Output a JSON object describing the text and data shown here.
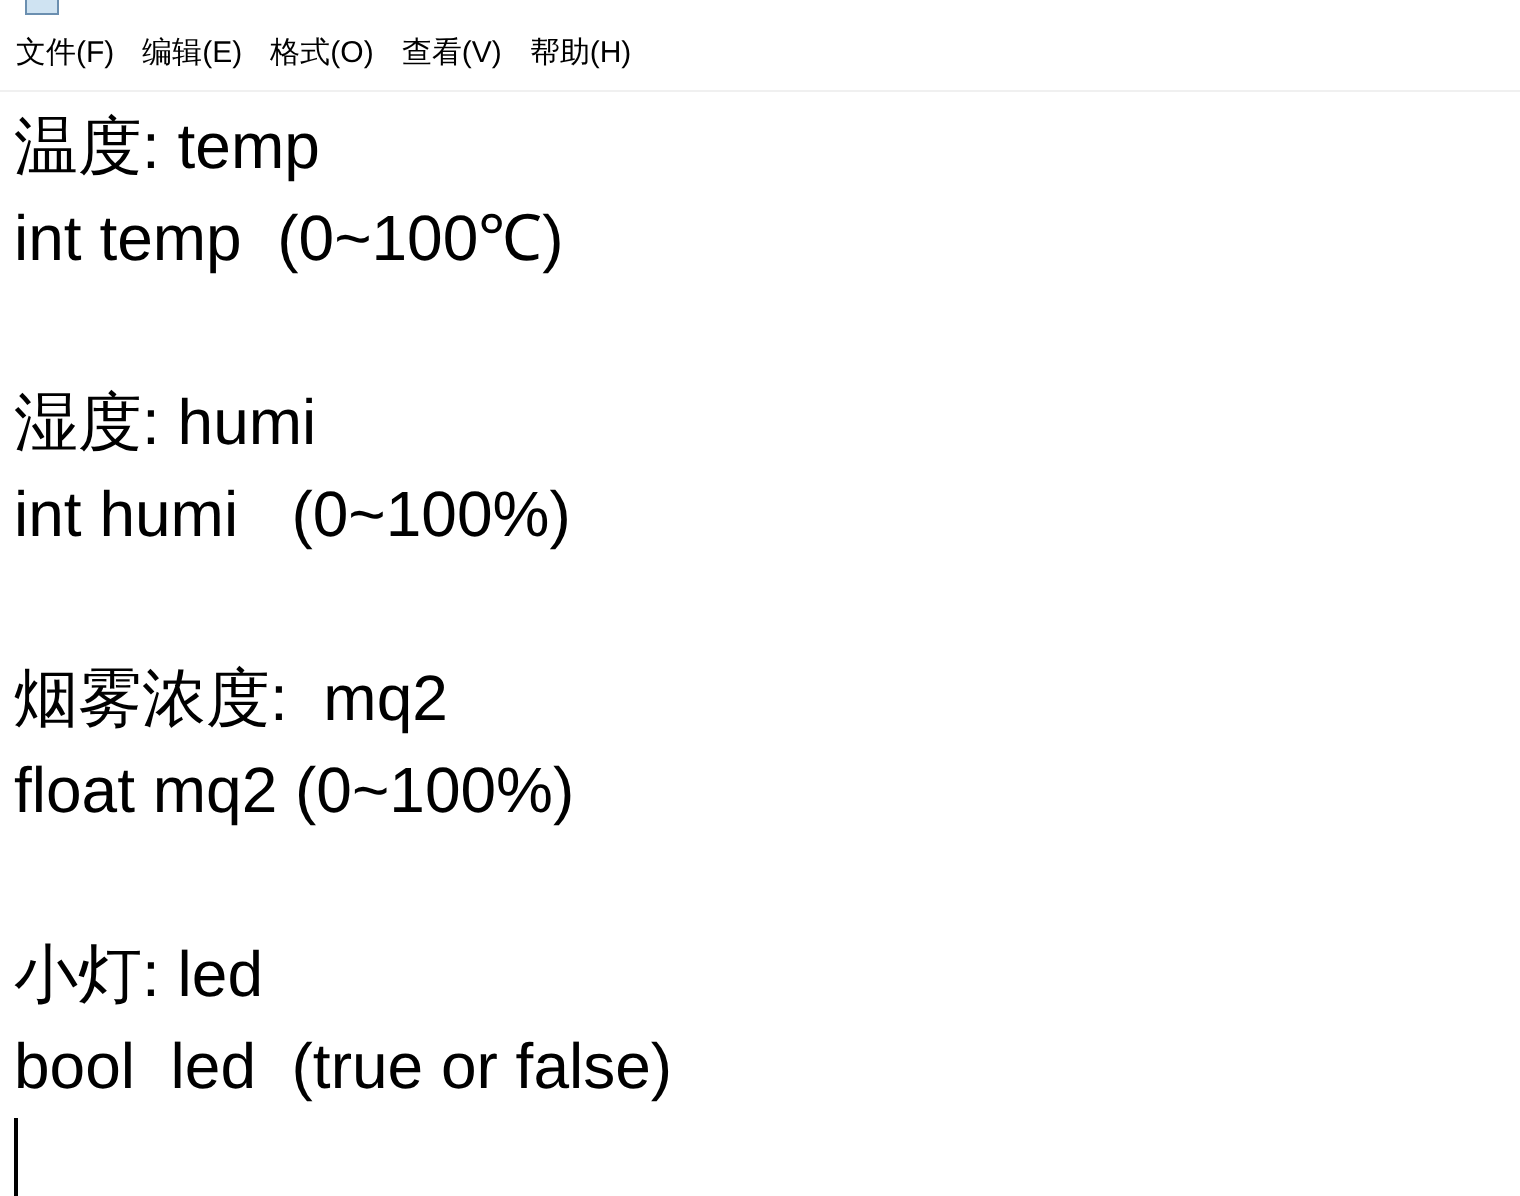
{
  "menu_bar": [
    "文件(F)",
    "编辑(E)",
    "格式(O)",
    "查看(V)",
    "帮助(H)"
  ],
  "document": {
    "paragraphs": [
      [
        "温度: temp",
        "int temp  (0~100℃)"
      ],
      [
        "湿度: humi",
        "int humi   (0~100%)"
      ],
      [
        "烟雾浓度:  mq2",
        "float mq2 (0~100%)"
      ],
      [
        "小灯: led",
        "bool  led  (true or false)"
      ]
    ]
  }
}
